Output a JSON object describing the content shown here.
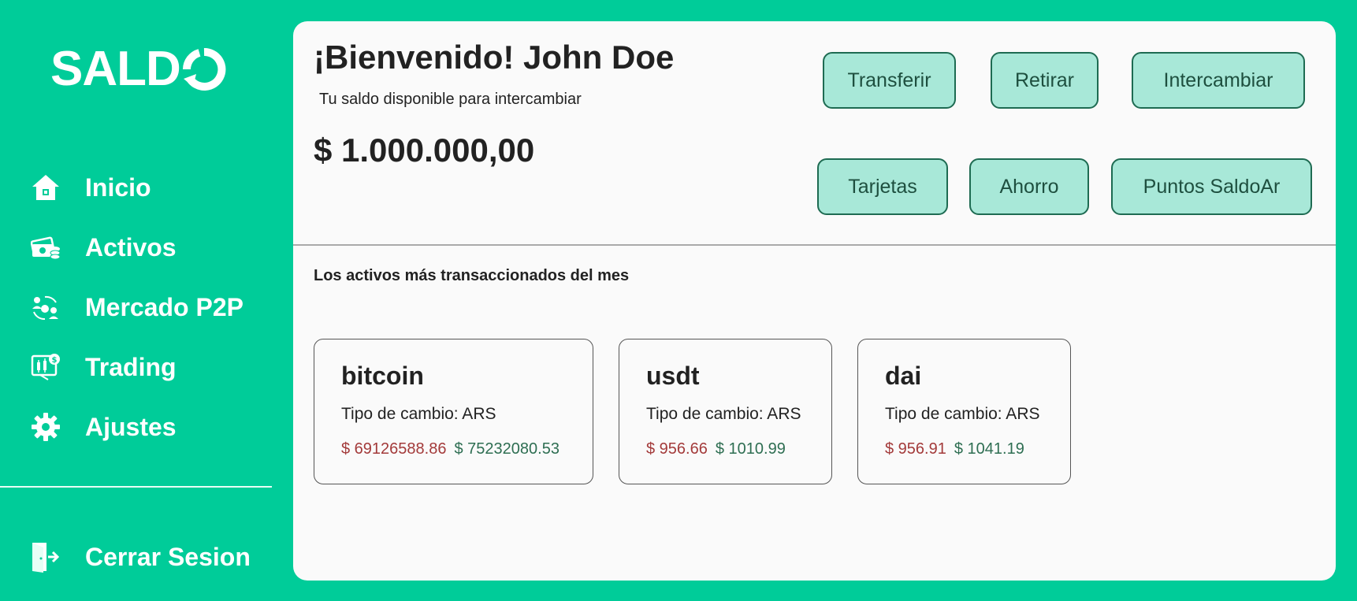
{
  "brand": {
    "logo_text": "SALD"
  },
  "sidebar": {
    "items": [
      {
        "label": "Inicio",
        "icon": "home-icon"
      },
      {
        "label": "Activos",
        "icon": "money-icon"
      },
      {
        "label": "Mercado P2P",
        "icon": "p2p-exchange-icon"
      },
      {
        "label": "Trading",
        "icon": "trading-chart-icon"
      },
      {
        "label": "Ajustes",
        "icon": "gear-icon"
      }
    ],
    "logout": {
      "label": "Cerrar Sesion",
      "icon": "logout-icon"
    }
  },
  "header": {
    "welcome": "¡Bienvenido! John Doe",
    "subtitle": "Tu saldo disponible para intercambiar",
    "balance": "$ 1.000.000,00"
  },
  "actions": {
    "transferir": "Transferir",
    "retirar": "Retirar",
    "intercambiar": "Intercambiar",
    "tarjetas": "Tarjetas",
    "ahorro": "Ahorro",
    "puntos": "Puntos SaldoAr"
  },
  "assets_section": {
    "title": "Los activos más transaccionados del mes",
    "cards": [
      {
        "name": "bitcoin",
        "type": "Tipo de cambio: ARS",
        "sell": "$ 69126588.86",
        "buy": "$ 75232080.53"
      },
      {
        "name": "usdt",
        "type": "Tipo de cambio: ARS",
        "sell": "$ 956.66",
        "buy": "$ 1010.99"
      },
      {
        "name": "dai",
        "type": "Tipo de cambio: ARS",
        "sell": "$ 956.91",
        "buy": "$ 1041.19"
      }
    ]
  },
  "colors": {
    "brand_green": "#00cc99",
    "button_fill": "#a8e8d8",
    "button_border": "#1e6b52",
    "sell_red": "#a33a3a",
    "buy_green": "#2e6e52"
  }
}
